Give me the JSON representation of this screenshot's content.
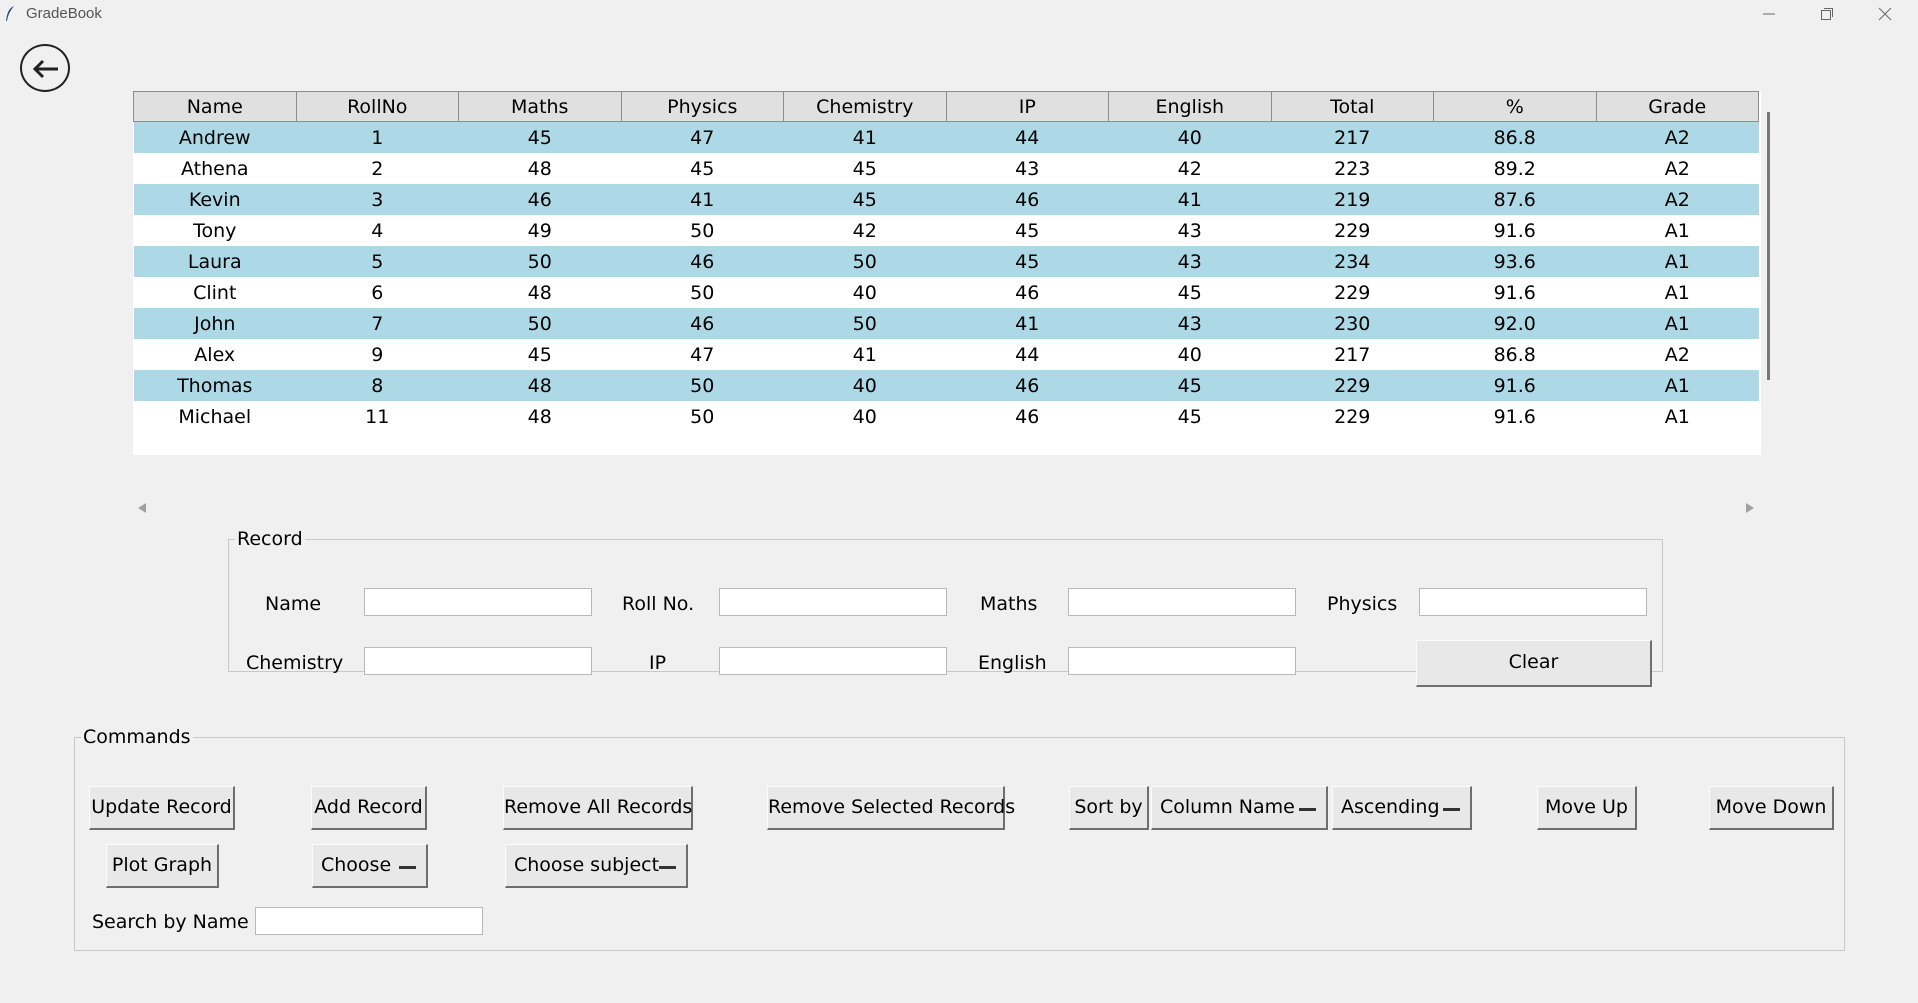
{
  "window": {
    "title": "GradeBook"
  },
  "table": {
    "columns": [
      "Name",
      "RollNo",
      "Maths",
      "Physics",
      "Chemistry",
      "IP",
      "English",
      "Total",
      "%",
      "Grade"
    ],
    "rows": [
      [
        "Andrew",
        "1",
        "45",
        "47",
        "41",
        "44",
        "40",
        "217",
        "86.8",
        "A2"
      ],
      [
        "Athena",
        "2",
        "48",
        "45",
        "45",
        "43",
        "42",
        "223",
        "89.2",
        "A2"
      ],
      [
        "Kevin",
        "3",
        "46",
        "41",
        "45",
        "46",
        "41",
        "219",
        "87.6",
        "A2"
      ],
      [
        "Tony",
        "4",
        "49",
        "50",
        "42",
        "45",
        "43",
        "229",
        "91.6",
        "A1"
      ],
      [
        "Laura",
        "5",
        "50",
        "46",
        "50",
        "45",
        "43",
        "234",
        "93.6",
        "A1"
      ],
      [
        "Clint",
        "6",
        "48",
        "50",
        "40",
        "46",
        "45",
        "229",
        "91.6",
        "A1"
      ],
      [
        "John",
        "7",
        "50",
        "46",
        "50",
        "41",
        "43",
        "230",
        "92.0",
        "A1"
      ],
      [
        "Alex",
        "9",
        "45",
        "47",
        "41",
        "44",
        "40",
        "217",
        "86.8",
        "A2"
      ],
      [
        "Thomas",
        "8",
        "48",
        "50",
        "40",
        "46",
        "45",
        "229",
        "91.6",
        "A1"
      ],
      [
        "Michael",
        "11",
        "48",
        "50",
        "40",
        "46",
        "45",
        "229",
        "91.6",
        "A1"
      ]
    ]
  },
  "record": {
    "title": "Record",
    "name_label": "Name",
    "rollno_label": "Roll No.",
    "maths_label": "Maths",
    "physics_label": "Physics",
    "chemistry_label": "Chemistry",
    "ip_label": "IP",
    "english_label": "English",
    "clear_label": "Clear"
  },
  "commands": {
    "title": "Commands",
    "update_label": "Update Record",
    "add_label": "Add Record",
    "remove_all_label": "Remove All Records",
    "remove_selected_label": "Remove Selected Records",
    "sort_by_label": "Sort by",
    "column_name_value": "Column Name",
    "order_value": "Ascending",
    "move_up_label": "Move Up",
    "move_down_label": "Move Down",
    "plot_graph_label": "Plot Graph",
    "choose_value": "Choose",
    "choose_subject_value": "Choose subject",
    "search_label": "Search by Name",
    "search_value": ""
  },
  "colors": {
    "row_highlight": "#add8e6",
    "header_bg": "#e0e0e0",
    "window_bg": "#f0f0f0"
  }
}
